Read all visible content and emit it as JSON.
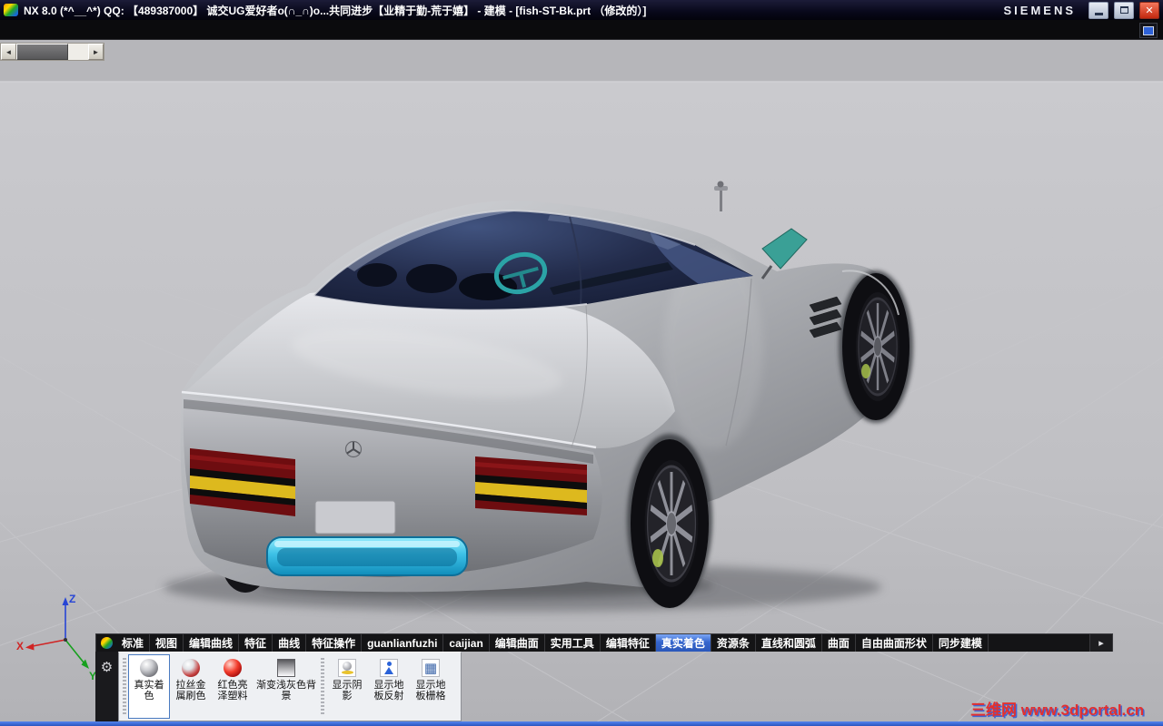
{
  "window": {
    "title": "NX 8.0 (*^__^*) QQ: 【489387000】 诚交UG爱好者o(∩_∩)o...共同进步【业精于勤-荒于嬉】 - 建模 - [fish-ST-Bk.prt （修改的）]",
    "brand": "SIEMENS"
  },
  "icons": {
    "close": "✕",
    "minimize": "css-bar",
    "maximize": "css-box",
    "scroll_left": "◄",
    "scroll_right": "►",
    "gear": "⚙",
    "overflow": "▸",
    "grid_glyph": "▦"
  },
  "tabs": {
    "items": [
      {
        "label": "标准",
        "active": false
      },
      {
        "label": "视图",
        "active": false
      },
      {
        "label": "编辑曲线",
        "active": false
      },
      {
        "label": "特征",
        "active": false
      },
      {
        "label": "曲线",
        "active": false
      },
      {
        "label": "特征操作",
        "active": false
      },
      {
        "label": "guanlianfuzhi",
        "active": false
      },
      {
        "label": "caijian",
        "active": false
      },
      {
        "label": "编辑曲面",
        "active": false
      },
      {
        "label": "实用工具",
        "active": false
      },
      {
        "label": "编辑特征",
        "active": false
      },
      {
        "label": "真实着色",
        "active": true
      },
      {
        "label": "资源条",
        "active": false
      },
      {
        "label": "直线和圆弧",
        "active": false
      },
      {
        "label": "曲面",
        "active": false
      },
      {
        "label": "自由曲面形状",
        "active": false
      },
      {
        "label": "同步建模",
        "active": false
      }
    ]
  },
  "toolbar": {
    "buttons": [
      {
        "label": "真实着色",
        "icon": "sphere-gray",
        "pressed": true
      },
      {
        "label": "拉丝金属刷色",
        "icon": "sphere-metal",
        "pressed": false
      },
      {
        "label": "红色亮泽塑料",
        "icon": "sphere-red",
        "pressed": false
      },
      {
        "label": "渐变浅灰色背景",
        "icon": "gradient-square",
        "pressed": false
      },
      {
        "label": "显示阴影",
        "icon": "shadow",
        "pressed": false
      },
      {
        "label": "显示地板反射",
        "icon": "floor-reflection",
        "pressed": false
      },
      {
        "label": "显示地板栅格",
        "icon": "floor-grid",
        "pressed": false
      }
    ]
  },
  "viewport": {
    "axes": {
      "x": "X",
      "y": "Y",
      "z": "Z"
    },
    "watermark": "三维网 www.3dportal.cn"
  }
}
